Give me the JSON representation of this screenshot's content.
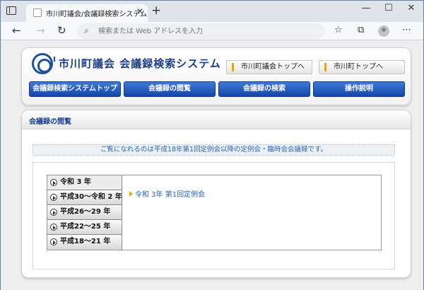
{
  "browser": {
    "tab_title": "市川町議会/会議録検索システム",
    "tab_close": "✕",
    "new_tab": "+",
    "minimize": "—",
    "maximize": "☐",
    "close": "✕",
    "back": "←",
    "forward": "→",
    "reload": "↻",
    "address_placeholder": "検索または Web アドレスを入力",
    "search_glyph": "⌕",
    "favorites_icon": "☆",
    "collections_icon": "⧉",
    "menu_icon": "⋯"
  },
  "header": {
    "site_title": "市川町議会 会議録検索システム",
    "links": [
      {
        "label": "市川町議会トップへ"
      },
      {
        "label": "市川町トップへ"
      }
    ],
    "nav": [
      {
        "label": "会議録検索システムトップ"
      },
      {
        "label": "会議録の閲覧"
      },
      {
        "label": "会議録の検索"
      },
      {
        "label": "操作説明"
      }
    ]
  },
  "main": {
    "section_title": "会議録の閲覧",
    "notice": "ご覧になれるのは平成18年第1回定例会以降の定例会・臨時会会議録です。",
    "years": [
      {
        "label": "令和 3 年"
      },
      {
        "label": "平成30～令和 2 年"
      },
      {
        "label": "平成26～29 年"
      },
      {
        "label": "平成22～25 年"
      },
      {
        "label": "平成18～21 年"
      }
    ],
    "session_link": "令和 3年 第1回定例会"
  },
  "colors": {
    "accent": "#1d4f9e",
    "nav_button": "#1446a8",
    "link": "#2a64b8",
    "marker": "#e8a800"
  }
}
